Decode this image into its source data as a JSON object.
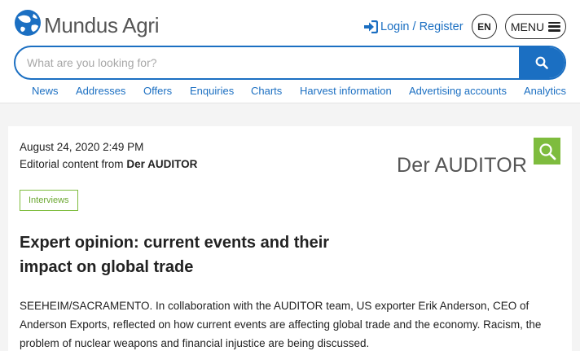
{
  "header": {
    "brand": "Mundus Agri",
    "login_label": "Login / Register",
    "language": "EN",
    "menu_label": "MENU"
  },
  "search": {
    "placeholder": "What are you looking for?"
  },
  "nav": {
    "items": [
      "News",
      "Addresses",
      "Offers",
      "Enquiries",
      "Charts",
      "Harvest information",
      "Advertising accounts",
      "Analytics"
    ]
  },
  "article": {
    "date": "August 24, 2020 2:49 PM",
    "source_prefix": "Editorial content from",
    "source_name": "Der AUDITOR",
    "source_logo_text": "Der AUDITOR",
    "tag": "Interviews",
    "title": "Expert opinion: current events and their impact on global trade",
    "body": "SEEHEIM/SACRAMENTO. In collaboration with the AUDITOR team, US exporter Erik Anderson, CEO of Anderson Exports, reflected on how current events are affecting global trade and the economy. Racism, the problem of nuclear weapons and financial injustice are being discussed."
  },
  "colors": {
    "brand_blue": "#1b6fc2",
    "tag_green": "#7ebc3e",
    "page_bg": "#f4f4f4"
  },
  "icons": {
    "logo": "globe-logo-icon",
    "login": "sign-in-icon",
    "menu": "hamburger-icon",
    "search": "search-icon",
    "source_logo": "magnifier-icon"
  }
}
